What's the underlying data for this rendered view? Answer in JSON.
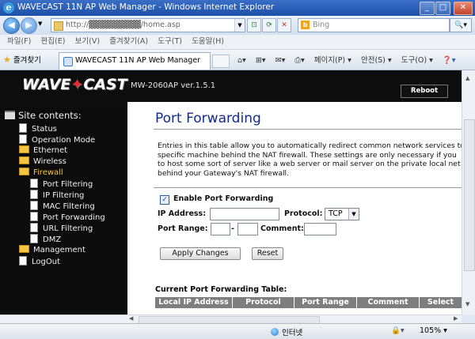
{
  "window": {
    "title": "WAVECAST 11N AP Web Manager - Windows Internet Explorer",
    "minimize": "_",
    "maximize": "□",
    "close": "✕"
  },
  "address_bar": {
    "url": "http://▓▓▓▓▓▓▓▓▓/home.asp",
    "search_placeholder": "Bing"
  },
  "menu": [
    "파일(F)",
    "편집(E)",
    "보기(V)",
    "즐겨찾기(A)",
    "도구(T)",
    "도움말(H)"
  ],
  "favorites_label": "즐겨찾기",
  "tab": {
    "label": "WAVECAST 11N AP Web Manager"
  },
  "command_bar": [
    "페이지(P) ▾",
    "안전(S) ▾",
    "도구(O) ▾"
  ],
  "header": {
    "logo_part1": "WAVE",
    "logo_part2": "CAST",
    "model": "MW-2060AP ver.1.5.1",
    "reboot": "Reboot"
  },
  "sidebar": {
    "title": "Site contents:",
    "items": [
      {
        "label": "Status"
      },
      {
        "label": "Operation Mode"
      },
      {
        "label": "Ethernet"
      },
      {
        "label": "Wireless"
      },
      {
        "label": "Firewall"
      },
      {
        "label": "Port Filtering"
      },
      {
        "label": "IP Filtering"
      },
      {
        "label": "MAC Filtering"
      },
      {
        "label": "Port Forwarding"
      },
      {
        "label": "URL Filtering"
      },
      {
        "label": "DMZ"
      },
      {
        "label": "Management"
      },
      {
        "label": "LogOut"
      }
    ]
  },
  "page": {
    "title": "Port Forwarding",
    "description": [
      "Entries in this table allow you to automatically redirect common network services to",
      "specific machine behind the NAT firewall. These settings are only necessary if you",
      "to host some sort of server like a web server or mail server on the private local net",
      "behind your Gateway's NAT firewall."
    ],
    "enable_label": "Enable Port Forwarding",
    "enable_checked": true,
    "ip_label": "IP Address:",
    "ip_value": "",
    "protocol_label": "Protocol:",
    "protocol_value": "TCP",
    "port_range_label": "Port Range:",
    "port_from": "",
    "port_dash": "-",
    "port_to": "",
    "comment_label": "Comment:",
    "comment_value": "",
    "apply_button": "Apply Changes",
    "reset_button": "Reset",
    "table_title": "Current Port Forwarding Table:",
    "table_columns": [
      "Local IP Address",
      "Protocol",
      "Port Range",
      "Comment",
      "Select"
    ]
  },
  "statusbar": {
    "zone": "인터넷",
    "zoom": "105%  ▾"
  }
}
